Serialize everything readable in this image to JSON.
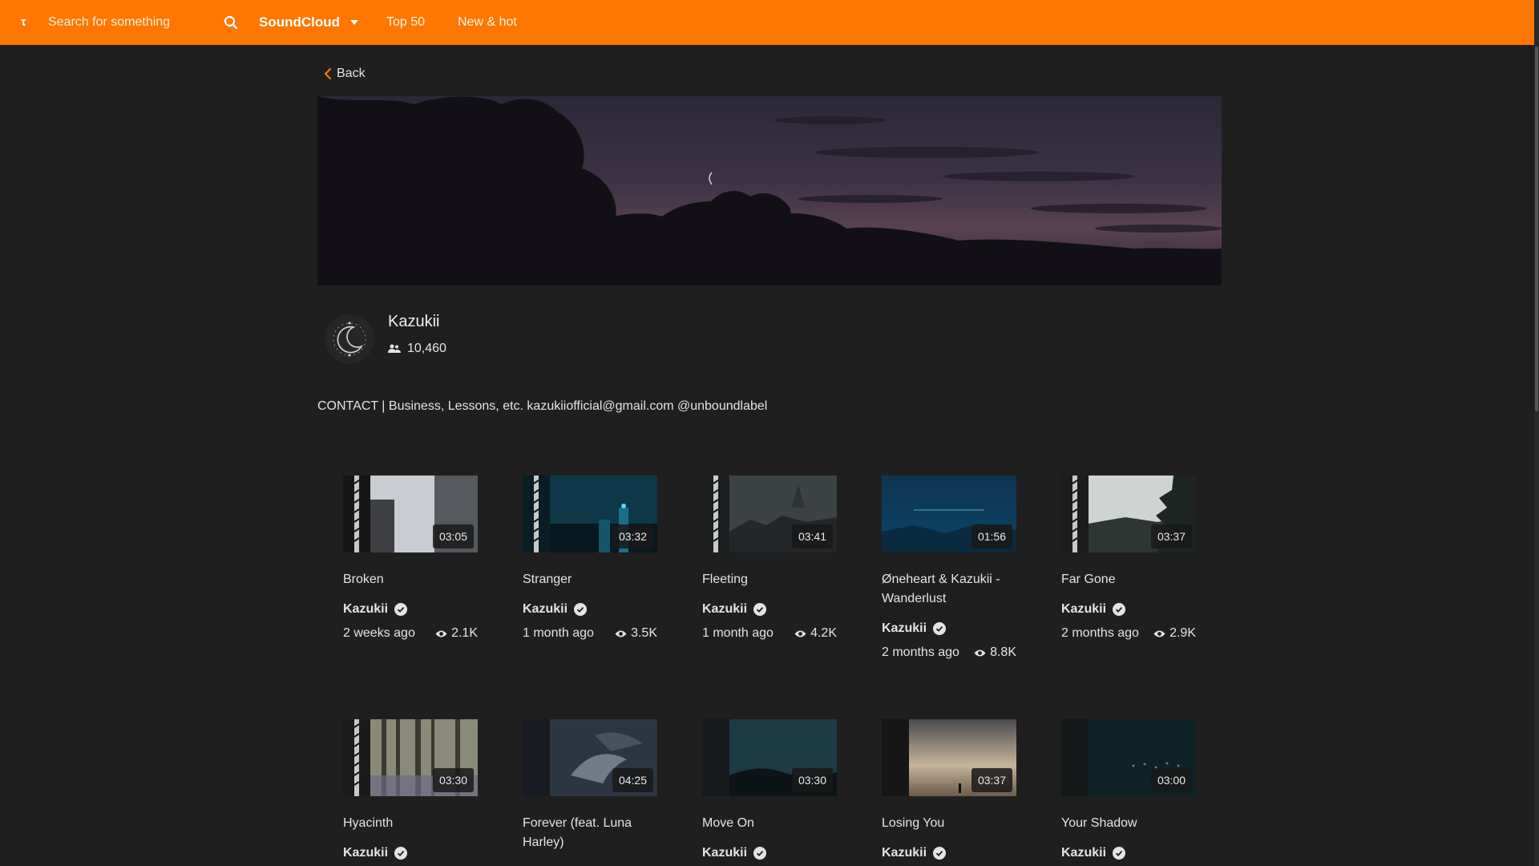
{
  "topbar": {
    "logo": "τ",
    "search_placeholder": "Search for something",
    "source": "SoundCloud",
    "nav": [
      "Top 50",
      "New & hot"
    ]
  },
  "header": {
    "back_label": "Back",
    "artist": "Kazukii",
    "followers": "10,460",
    "description": "CONTACT | Business, Lessons, etc. kazukiiofficial@gmail.com @unboundlabel"
  },
  "tracks": [
    {
      "title": "Broken",
      "artist": "Kazukii",
      "age": "2 weeks ago",
      "views": "2.1K",
      "duration": "03:05"
    },
    {
      "title": "Stranger",
      "artist": "Kazukii",
      "age": "1 month ago",
      "views": "3.5K",
      "duration": "03:32"
    },
    {
      "title": "Fleeting",
      "artist": "Kazukii",
      "age": "1 month ago",
      "views": "4.2K",
      "duration": "03:41"
    },
    {
      "title": "Øneheart & Kazukii - Wanderlust",
      "artist": "Kazukii",
      "age": "2 months ago",
      "views": "8.8K",
      "duration": "01:56"
    },
    {
      "title": "Far Gone",
      "artist": "Kazukii",
      "age": "2 months ago",
      "views": "2.9K",
      "duration": "03:37"
    },
    {
      "title": "Hyacinth",
      "artist": "Kazukii",
      "age": "",
      "views": "",
      "duration": "03:30"
    },
    {
      "title": "Forever (feat. Luna Harley)",
      "artist": "",
      "age": "",
      "views": "",
      "duration": "04:25"
    },
    {
      "title": "Move On",
      "artist": "Kazukii",
      "age": "",
      "views": "",
      "duration": "03:30"
    },
    {
      "title": "Losing You",
      "artist": "Kazukii",
      "age": "",
      "views": "",
      "duration": "03:37"
    },
    {
      "title": "Your Shadow",
      "artist": "Kazukii",
      "age": "",
      "views": "",
      "duration": "03:00"
    }
  ],
  "colors": {
    "accent": "#ff7700",
    "background": "#1f1f1f",
    "text": "#e4e4e4"
  }
}
